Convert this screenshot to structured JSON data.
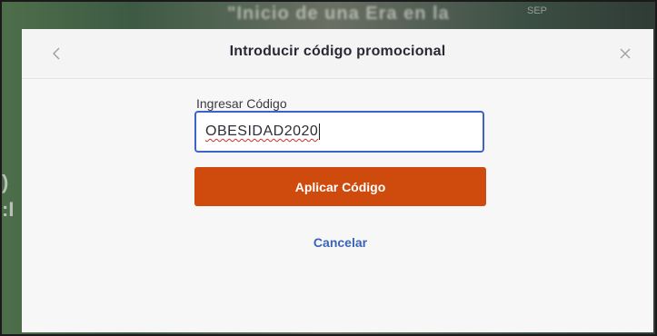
{
  "backdrop": {
    "heading": "\"Inicio de una Era en la",
    "date_tag": "SEP"
  },
  "modal": {
    "title": "Introducir código promocional",
    "back_icon": "chevron-left-icon",
    "close_icon": "close-icon",
    "field_label": "Ingresar Código",
    "code_value": "OBESIDAD2020",
    "apply_label": "Aplicar Código",
    "cancel_label": "Cancelar"
  },
  "colors": {
    "apply_button": "#cf4a0d",
    "input_focus_border": "#3c64c8",
    "link": "#3a63b8"
  }
}
